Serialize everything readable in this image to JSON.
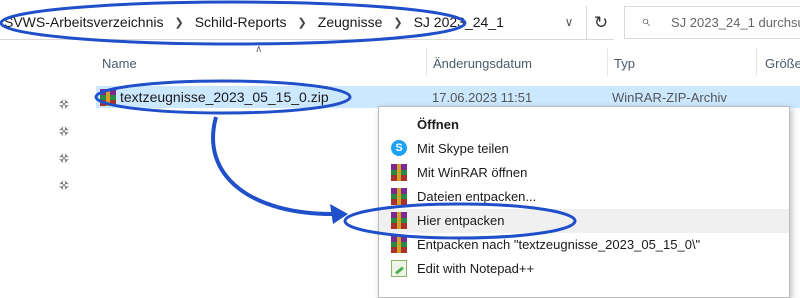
{
  "breadcrumb": [
    "SVWS-Arbeitsverzeichnis",
    "Schild-Reports",
    "Zeugnisse",
    "SJ 2023_24_1"
  ],
  "search": {
    "placeholder": "SJ 2023_24_1 durchsu"
  },
  "columns": {
    "name": "Name",
    "date": "Änderungsdatum",
    "type": "Typ",
    "size": "Größe"
  },
  "file": {
    "name": "textzeugnisse_2023_05_15_0.zip",
    "date": "17.06.2023 11:51",
    "type": "WinRAR-ZIP-Archiv"
  },
  "context_menu": [
    {
      "label": "Öffnen",
      "icon": "none"
    },
    {
      "label": "Mit Skype teilen",
      "icon": "skype-icon"
    },
    {
      "label": "Mit WinRAR öffnen",
      "icon": "winrar-icon"
    },
    {
      "label": "Dateien entpacken...",
      "icon": "winrar-icon"
    },
    {
      "label": "Hier entpacken",
      "icon": "winrar-icon"
    },
    {
      "label": "Entpacken nach \"textzeugnisse_2023_05_15_0\\\"",
      "icon": "winrar-icon"
    },
    {
      "label": "Edit with Notepad++",
      "icon": "notepad-plus-plus-icon"
    }
  ],
  "annotation_color": "#1f4fc9"
}
